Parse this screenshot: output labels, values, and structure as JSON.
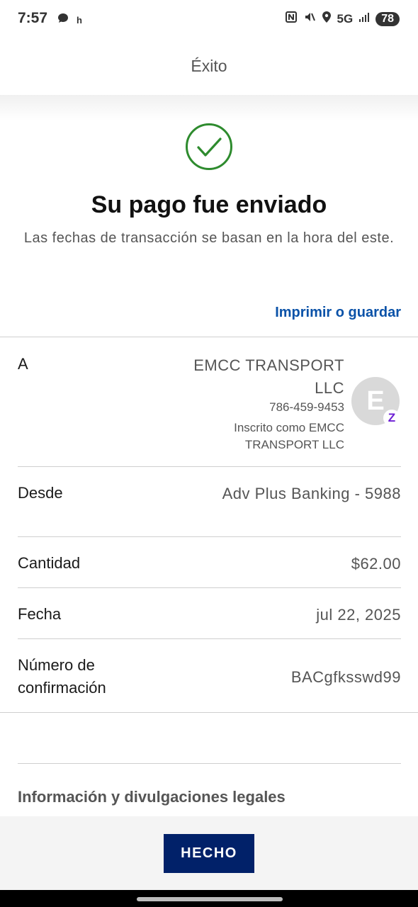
{
  "status_bar": {
    "time": "7:57",
    "left_icons": [
      "chat-bubble-icon",
      "h-icon"
    ],
    "h_glyph": "h",
    "network": "5G",
    "battery": "78"
  },
  "header": {
    "title": "Éxito"
  },
  "confirmation": {
    "icon": "checkmark-circle-icon",
    "title": "Su pago fue enviado",
    "subtitle": "Las fechas de transacción se basan en la hora del este."
  },
  "print_link": "Imprimir o guardar",
  "details": {
    "to": {
      "label": "A",
      "name": "EMCC TRANSPORT LLC",
      "phone": "786-459-9453",
      "enrolled_as": "Inscrito como EMCC TRANSPORT LLC",
      "avatar_initial": "E",
      "badge": "Z"
    },
    "from": {
      "label": "Desde",
      "value": "Adv Plus Banking - 5988"
    },
    "amount": {
      "label": "Cantidad",
      "value": "$62.00"
    },
    "date": {
      "label": "Fecha",
      "value": "jul 22, 2025"
    },
    "confirmation_number": {
      "label": "Número de confirmación",
      "value": "BACgfksswd99"
    }
  },
  "legal": {
    "heading": "Información y divulgaciones legales"
  },
  "footer": {
    "done_label": "HECHO"
  },
  "colors": {
    "accent_link": "#0a52a8",
    "success_green": "#2e8b2e",
    "button_navy": "#012169",
    "zelle_purple": "#6d1ed4"
  }
}
